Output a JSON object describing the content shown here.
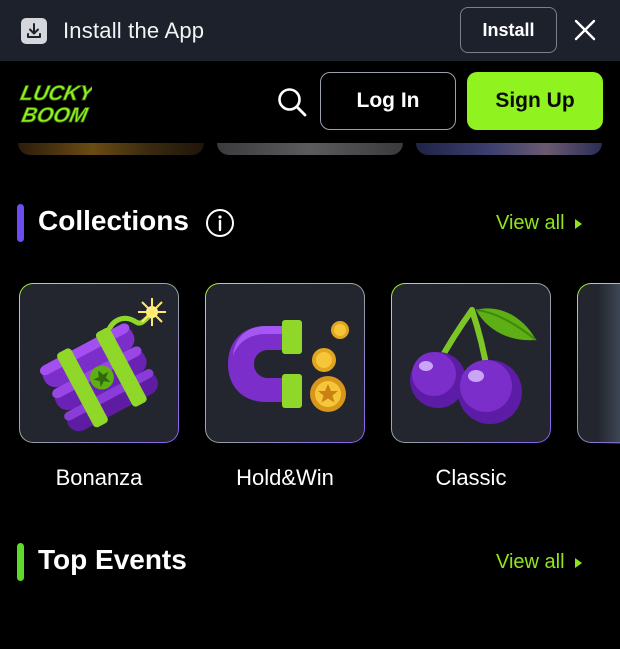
{
  "install_bar": {
    "text": "Install the App",
    "install_label": "Install",
    "icons": [
      "download-icon",
      "close-icon"
    ]
  },
  "header": {
    "logo_line1": "LUCKY",
    "logo_line2": "BOOM",
    "login_label": "Log In",
    "signup_label": "Sign Up",
    "icons": [
      "search-icon"
    ]
  },
  "collections": {
    "title": "Collections",
    "view_all": "View all",
    "items": [
      {
        "label": "Bonanza",
        "icon": "dynamite-icon"
      },
      {
        "label": "Hold&Win",
        "icon": "magnet-coins-icon"
      },
      {
        "label": "Classic",
        "icon": "cherries-icon"
      }
    ]
  },
  "top_events": {
    "title": "Top Events",
    "view_all": "View all"
  },
  "colors": {
    "accent_green": "#90f21f",
    "accent_purple": "#6d4cf0",
    "banner_bg": "#1c212c",
    "card_bg": "#23262e"
  }
}
